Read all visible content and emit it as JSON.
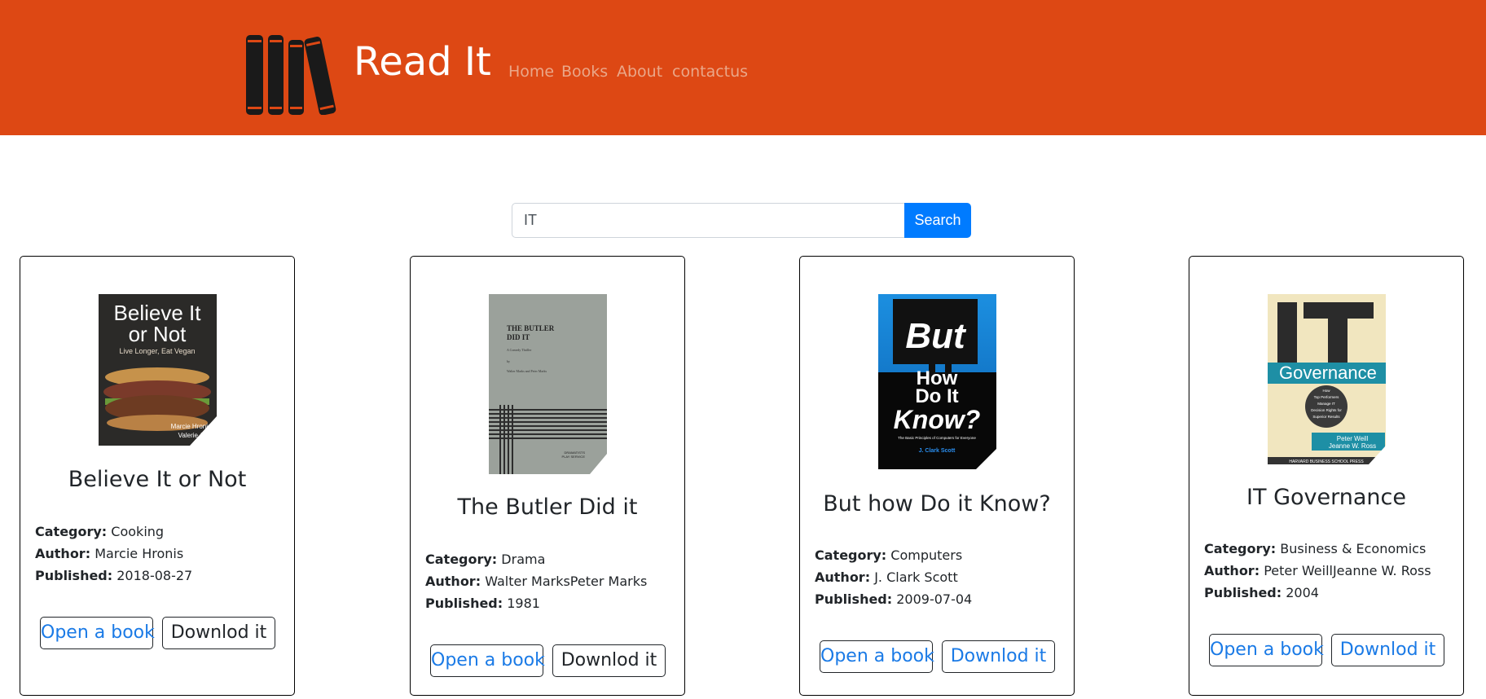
{
  "app": {
    "brand": "Read It",
    "logo_icon": "books-icon",
    "accent": "#dd4814"
  },
  "nav": {
    "items": [
      {
        "label": "Home"
      },
      {
        "label": "Books"
      },
      {
        "label": "About"
      },
      {
        "label": "contactus"
      }
    ]
  },
  "search": {
    "value": "IT",
    "button_label": "Search"
  },
  "labels": {
    "category": "Category:",
    "author": "Author:",
    "published": "Published:"
  },
  "books": [
    {
      "title": "Believe It or Not",
      "category": "Cooking",
      "author": "Marcie Hronis",
      "published": "2018-08-27",
      "cover": {
        "line1": "Believe It",
        "line2": "or Not",
        "subtitle": "Live Longer, Eat Vegan",
        "authors1": "Marcie Hronis",
        "authors2": "Valerie Ang"
      },
      "open_label": "Open a book",
      "download_label": "Downlod it"
    },
    {
      "title": "The Butler Did it",
      "category": "Drama",
      "author": "Walter MarksPeter Marks",
      "published": "1981",
      "cover": {
        "line1": "THE BUTLER",
        "line2": "DID IT",
        "subtitle": "A Comedy Thriller",
        "by": "by",
        "authors": "Walter Marks and Peter Marks",
        "publisher1": "DRAMATISTS",
        "publisher2": "PLAY SERVICE"
      },
      "open_label": "Open a book",
      "download_label": "Downlod it"
    },
    {
      "title": "But how Do it Know?",
      "category": "Computers",
      "author": "J. Clark Scott",
      "published": "2009-07-04",
      "cover": {
        "line1": "But",
        "line2": "How",
        "line3": "Do It",
        "line4": "Know?",
        "subtitle": "The Basic Principles of Computers for Everyone",
        "author": "J. Clark Scott"
      },
      "open_label": "Open a book",
      "download_label": "Downlod it"
    },
    {
      "title": "IT Governance",
      "category": "Business & Economics",
      "author": "Peter WeillJeanne W. Ross",
      "published": "2004",
      "cover": {
        "big": "IT",
        "word": "Governance",
        "circle1": "How",
        "circle2": "Top Performers",
        "circle3": "Manage IT",
        "circle4": "Decision Rights for",
        "circle5": "Superior Results",
        "author1": "Peter Weill",
        "author2": "Jeanne W. Ross",
        "publisher": "HARVARD BUSINESS SCHOOL PRESS"
      },
      "open_label": "Open a book",
      "download_label": "Downlod it"
    }
  ]
}
